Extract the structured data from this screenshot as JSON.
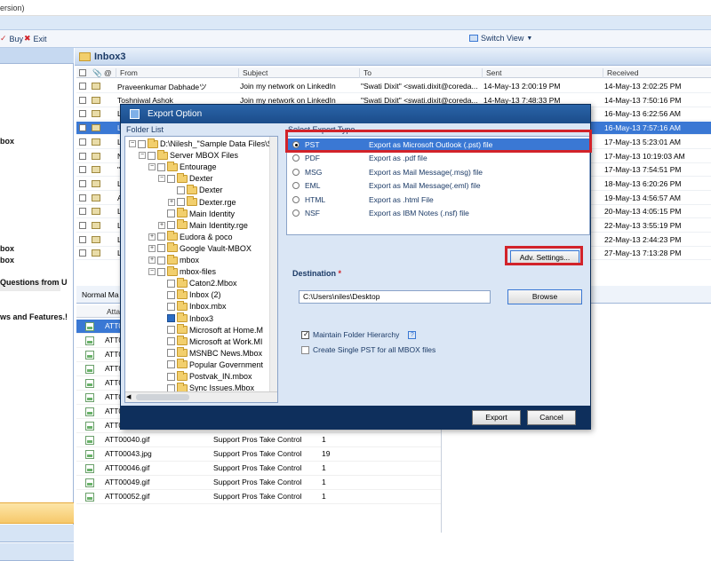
{
  "window": {
    "title_fragment": "ersion)"
  },
  "toolbar": {
    "buy_label": "Buy",
    "exit_label": "Exit",
    "switch_view_label": "Switch View"
  },
  "left_pane": {
    "items": [
      "box",
      "box",
      "box",
      "Questions from U",
      "ws and Features.!"
    ]
  },
  "inbox": {
    "title": "Inbox3",
    "columns": [
      "From",
      "Subject",
      "To",
      "Sent",
      "Received"
    ],
    "rows": [
      {
        "from": "Praveenkumar Dabhadeツ",
        "subject": "Join my network on LinkedIn",
        "to": "\"Swati Dixit\" <swati.dixit@coreda...",
        "sent": "14-May-13 2:00:19 PM",
        "received": "14-May-13 2:02:25 PM",
        "selected": false
      },
      {
        "from": "Toshniwal Ashok",
        "subject": "Join my network on LinkedIn",
        "to": "\"Swati Dixit\" <swati.dixit@coreda...",
        "sent": "14-May-13 7:48:33 PM",
        "received": "14-May-13 7:50:16 PM",
        "selected": false
      },
      {
        "from": "L",
        "subject": "",
        "to": "",
        "sent": "",
        "received": "16-May-13 6:22:56 AM",
        "selected": false
      },
      {
        "from": "L",
        "subject": "",
        "to": "",
        "sent": "",
        "received": "16-May-13 7:57:16 AM",
        "selected": true
      },
      {
        "from": "L",
        "subject": "",
        "to": "",
        "sent": "",
        "received": "17-May-13 5:23:01 AM",
        "selected": false
      },
      {
        "from": "N",
        "subject": "",
        "to": "",
        "sent": "",
        "received": "17-May-13 10:19:03 AM",
        "selected": false
      },
      {
        "from": "\"",
        "subject": "",
        "to": "",
        "sent": "",
        "received": "17-May-13 7:54:51 PM",
        "selected": false
      },
      {
        "from": "L",
        "subject": "",
        "to": "",
        "sent": "",
        "received": "18-May-13 6:20:26 PM",
        "selected": false
      },
      {
        "from": "A",
        "subject": "",
        "to": "",
        "sent": "",
        "received": "19-May-13 4:56:57 AM",
        "selected": false
      },
      {
        "from": "L",
        "subject": "",
        "to": "",
        "sent": "",
        "received": "20-May-13 4:05:15 PM",
        "selected": false
      },
      {
        "from": "L",
        "subject": "",
        "to": "",
        "sent": "",
        "received": "22-May-13 3:55:19 PM",
        "selected": false
      },
      {
        "from": "L",
        "subject": "",
        "to": "",
        "sent": "",
        "received": "22-May-13 2:44:23 PM",
        "selected": false
      },
      {
        "from": "L",
        "subject": "",
        "to": "",
        "sent": "",
        "received": "27-May-13 7:13:28 PM",
        "selected": false
      }
    ]
  },
  "tabs": {
    "normal_label": "Normal Ma"
  },
  "attachments": {
    "column": "Atta",
    "rows": [
      {
        "name": "ATT0",
        "subject": "",
        "count": "",
        "selected": true
      },
      {
        "name": "ATT0",
        "subject": "",
        "count": ""
      },
      {
        "name": "ATT0",
        "subject": "",
        "count": ""
      },
      {
        "name": "ATT0",
        "subject": "",
        "count": ""
      },
      {
        "name": "ATT0",
        "subject": "",
        "count": ""
      },
      {
        "name": "ATT0",
        "subject": "",
        "count": ""
      },
      {
        "name": "ATT0",
        "subject": "",
        "count": ""
      },
      {
        "name": "ATT0",
        "subject": "",
        "count": ""
      },
      {
        "name": "ATT00040.gif",
        "subject": "Support Pros Take Control",
        "count": "1"
      },
      {
        "name": "ATT00043.jpg",
        "subject": "Support Pros Take Control",
        "count": "19"
      },
      {
        "name": "ATT00046.gif",
        "subject": "Support Pros Take Control",
        "count": "1"
      },
      {
        "name": "ATT00049.gif",
        "subject": "Support Pros Take Control",
        "count": "1"
      },
      {
        "name": "ATT00052.gif",
        "subject": "Support Pros Take Control",
        "count": "1"
      }
    ]
  },
  "dialog": {
    "title": "Export Option",
    "folder_list_label": "Folder List",
    "tree": [
      {
        "label": "D:\\Nilesh_\"Sample Data Files\\Se",
        "level": 0,
        "expander": "-",
        "checkbox": true,
        "checked": false
      },
      {
        "label": "Server MBOX Files",
        "level": 1,
        "expander": "-",
        "checkbox": true,
        "checked": false
      },
      {
        "label": "Entourage",
        "level": 2,
        "expander": "-",
        "checkbox": true,
        "checked": false
      },
      {
        "label": "Dexter",
        "level": 3,
        "expander": "-",
        "checkbox": true,
        "checked": false
      },
      {
        "label": "Dexter",
        "level": 4,
        "expander": "",
        "checkbox": true,
        "checked": false
      },
      {
        "label": "Dexter.rge",
        "level": 4,
        "expander": "+",
        "checkbox": true,
        "checked": false
      },
      {
        "label": "Main Identity",
        "level": 3,
        "expander": "",
        "checkbox": true,
        "checked": false
      },
      {
        "label": "Main Identity.rge",
        "level": 3,
        "expander": "+",
        "checkbox": true,
        "checked": false
      },
      {
        "label": "Eudora & poco",
        "level": 2,
        "expander": "+",
        "checkbox": true,
        "checked": false
      },
      {
        "label": "Google Vault-MBOX",
        "level": 2,
        "expander": "+",
        "checkbox": true,
        "checked": false
      },
      {
        "label": "mbox",
        "level": 2,
        "expander": "+",
        "checkbox": true,
        "checked": false
      },
      {
        "label": "mbox-files",
        "level": 2,
        "expander": "-",
        "checkbox": true,
        "checked": false
      },
      {
        "label": "Caton2.Mbox",
        "level": 3,
        "expander": "",
        "checkbox": true,
        "checked": false
      },
      {
        "label": "Inbox (2)",
        "level": 3,
        "expander": "",
        "checkbox": true,
        "checked": false
      },
      {
        "label": "Inbox.mbx",
        "level": 3,
        "expander": "",
        "checkbox": true,
        "checked": false
      },
      {
        "label": "Inbox3",
        "level": 3,
        "expander": "",
        "checkbox": true,
        "checked": true
      },
      {
        "label": "Microsoft at Home.M",
        "level": 3,
        "expander": "",
        "checkbox": true,
        "checked": false
      },
      {
        "label": "Microsoft at Work.MI",
        "level": 3,
        "expander": "",
        "checkbox": true,
        "checked": false
      },
      {
        "label": "MSNBC News.Mbox",
        "level": 3,
        "expander": "",
        "checkbox": true,
        "checked": false
      },
      {
        "label": "Popular Government",
        "level": 3,
        "expander": "",
        "checkbox": true,
        "checked": false
      },
      {
        "label": "Postvak_IN.mbox",
        "level": 3,
        "expander": "",
        "checkbox": true,
        "checked": false
      },
      {
        "label": "Sync Issues.Mbox",
        "level": 3,
        "expander": "",
        "checkbox": true,
        "checked": false
      }
    ],
    "export_type_label": "Select Export Type",
    "export_types": [
      {
        "name": "PST",
        "desc": "Export as Microsoft Outlook (.pst) file",
        "selected": true
      },
      {
        "name": "PDF",
        "desc": "Export as .pdf file",
        "selected": false
      },
      {
        "name": "MSG",
        "desc": "Export as Mail Message(.msg) file",
        "selected": false
      },
      {
        "name": "EML",
        "desc": "Export as Mail Message(.eml) file",
        "selected": false
      },
      {
        "name": "HTML",
        "desc": "Export as .html File",
        "selected": false
      },
      {
        "name": "NSF",
        "desc": "Export as IBM Notes (.nsf) file",
        "selected": false
      }
    ],
    "adv_settings_label": "Adv. Settings...",
    "destination_label": "Destination",
    "destination_required": "*",
    "destination_value": "C:\\Users\\niles\\Desktop",
    "browse_label": "Browse",
    "maintain_hierarchy_label": "Maintain Folder Hierarchy",
    "maintain_hierarchy_checked": true,
    "help_label": "?",
    "single_pst_label": "Create Single PST for all MBOX files",
    "single_pst_checked": false,
    "export_label": "Export",
    "cancel_label": "Cancel"
  },
  "colors": {
    "accent": "#3a78d4",
    "dialog_bg": "#dae6f5",
    "highlight": "#d2232a"
  }
}
